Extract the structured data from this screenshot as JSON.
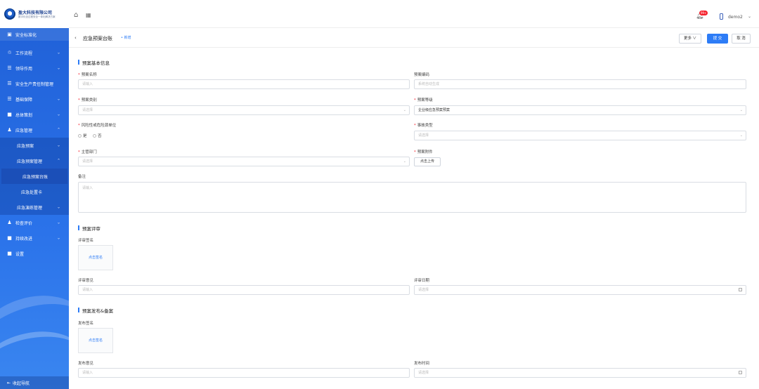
{
  "logo": {
    "title": "盈大科技有限公司",
    "subtitle": "数字化全过程安全一体化解决方案"
  },
  "sidebar": {
    "top": {
      "label": "安全标准化",
      "icon": "shield-icon"
    },
    "items": [
      {
        "label": "工作流程",
        "icon": "workflow-icon",
        "chevron": "⌄"
      },
      {
        "label": "领导作用",
        "icon": "list-icon",
        "chevron": "⌄"
      },
      {
        "label": "安全生产责任制管理",
        "icon": "list-icon"
      },
      {
        "label": "基础保障",
        "icon": "list-icon",
        "chevron": "⌄"
      },
      {
        "label": "总体策划",
        "icon": "folder-icon",
        "chevron": "⌄"
      },
      {
        "label": "应急管理",
        "icon": "person-icon",
        "chevron": "⌃"
      }
    ],
    "sub": [
      {
        "label": "应急预案",
        "chevron": "⌄"
      },
      {
        "label": "应急预案管理",
        "chevron": "⌃"
      }
    ],
    "subsub": [
      {
        "label": "应急预案台账"
      },
      {
        "label": "应急处置卡"
      }
    ],
    "sub2": {
      "label": "应急演练管理",
      "chevron": "⌄"
    },
    "items2": [
      {
        "label": "检查评价",
        "icon": "person-icon",
        "chevron": "⌄"
      },
      {
        "label": "持续改进",
        "icon": "folder-icon",
        "chevron": "⌄"
      },
      {
        "label": "设置",
        "icon": "gear-icon"
      }
    ],
    "collapse_label": "收起导航"
  },
  "header": {
    "badge": "99+",
    "username": "demo2"
  },
  "page": {
    "title": "应急预案台账",
    "crumb": "• 新增",
    "more_label": "更多 ∨",
    "submit_label": "提 交",
    "cancel_label": "取 消"
  },
  "form": {
    "section1": "预案基本信息",
    "plan_name_label": "预案名称",
    "plan_name_placeholder": "请输入",
    "plan_code_label": "预案编码",
    "plan_code_placeholder": "系统自动生成",
    "plan_type_label": "预案类别",
    "plan_type_placeholder": "请选择",
    "plan_level_label": "预案等级",
    "plan_level_value": "企业级应急预案预案",
    "risk_label": "风险性或危险源单位",
    "radio_yes": "是",
    "radio_no": "否",
    "event_label": "事故类型",
    "event_placeholder": "请选择",
    "dept_label": "主管部门",
    "dept_placeholder": "请选择",
    "attach_label": "预案附件",
    "upload_label": "点击上传",
    "remark_label": "备注",
    "remark_placeholder": "请输入",
    "section2": "预案评审",
    "review_sign_label": "评审签名",
    "review_sign_action": "点击签名",
    "review_opinion_label": "评审意见",
    "review_opinion_placeholder": "请输入",
    "review_date_label": "评审日期",
    "review_date_placeholder": "请选择",
    "section3": "预案发布&备案",
    "publish_sign_label": "发布签名",
    "publish_sign_action": "点击签名",
    "publish_opinion_label": "发布意见",
    "publish_opinion_placeholder": "请输入",
    "publish_time_label": "发布时间",
    "publish_time_placeholder": "请选择"
  },
  "colors": {
    "primary": "#2d7cf6",
    "sidebar": "#2b6fe6",
    "required": "#f5222d"
  }
}
